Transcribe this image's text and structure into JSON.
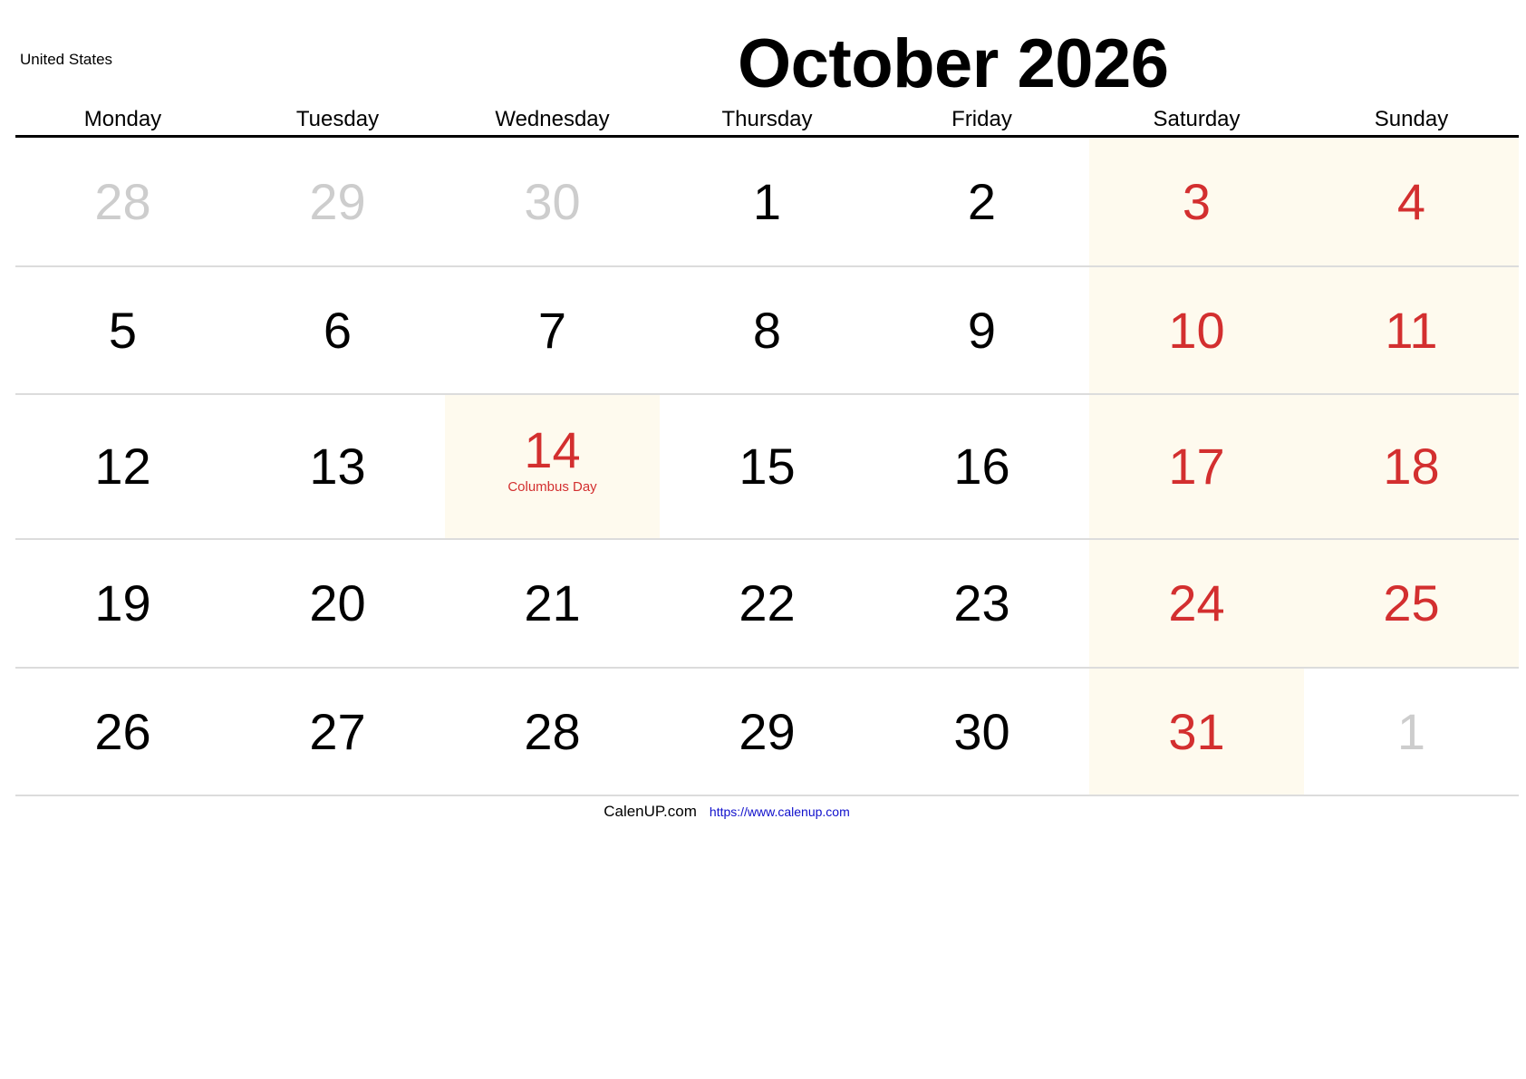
{
  "header": {
    "country": "United States",
    "title": "October 2026"
  },
  "weekdays": [
    "Monday",
    "Tuesday",
    "Wednesday",
    "Thursday",
    "Friday",
    "Saturday",
    "Sunday"
  ],
  "colors": {
    "weekend_text": "#d32f2f",
    "holiday_text": "#d32f2f",
    "other_month_text": "#cdcdcd",
    "weekend_bg": "#fefaee",
    "link": "#1010cc"
  },
  "weeks": [
    [
      {
        "day": "28",
        "type": "other"
      },
      {
        "day": "29",
        "type": "other"
      },
      {
        "day": "30",
        "type": "other"
      },
      {
        "day": "1",
        "type": "normal"
      },
      {
        "day": "2",
        "type": "normal"
      },
      {
        "day": "3",
        "type": "weekend"
      },
      {
        "day": "4",
        "type": "weekend"
      }
    ],
    [
      {
        "day": "5",
        "type": "normal"
      },
      {
        "day": "6",
        "type": "normal"
      },
      {
        "day": "7",
        "type": "normal"
      },
      {
        "day": "8",
        "type": "normal"
      },
      {
        "day": "9",
        "type": "normal"
      },
      {
        "day": "10",
        "type": "weekend"
      },
      {
        "day": "11",
        "type": "weekend"
      }
    ],
    [
      {
        "day": "12",
        "type": "normal"
      },
      {
        "day": "13",
        "type": "normal"
      },
      {
        "day": "14",
        "type": "holiday",
        "holiday": "Columbus Day"
      },
      {
        "day": "15",
        "type": "normal"
      },
      {
        "day": "16",
        "type": "normal"
      },
      {
        "day": "17",
        "type": "weekend"
      },
      {
        "day": "18",
        "type": "weekend"
      }
    ],
    [
      {
        "day": "19",
        "type": "normal"
      },
      {
        "day": "20",
        "type": "normal"
      },
      {
        "day": "21",
        "type": "normal"
      },
      {
        "day": "22",
        "type": "normal"
      },
      {
        "day": "23",
        "type": "normal"
      },
      {
        "day": "24",
        "type": "weekend"
      },
      {
        "day": "25",
        "type": "weekend"
      }
    ],
    [
      {
        "day": "26",
        "type": "normal"
      },
      {
        "day": "27",
        "type": "normal"
      },
      {
        "day": "28",
        "type": "normal"
      },
      {
        "day": "29",
        "type": "normal"
      },
      {
        "day": "30",
        "type": "normal"
      },
      {
        "day": "31",
        "type": "weekend"
      },
      {
        "day": "1",
        "type": "other"
      }
    ]
  ],
  "footer": {
    "brand": "CalenUP.com",
    "url": "https://www.calenup.com"
  }
}
